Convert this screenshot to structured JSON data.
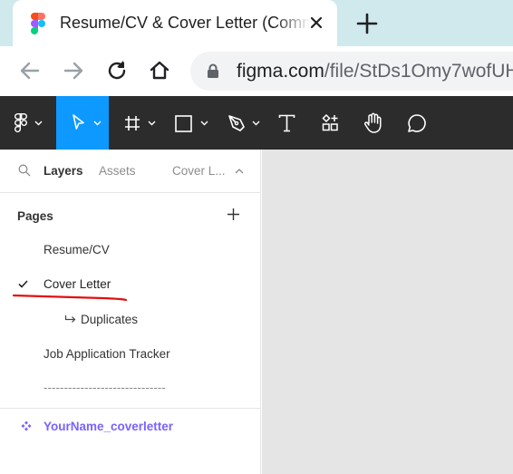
{
  "browser": {
    "tab_title": "Resume/CV & Cover Letter (Community)",
    "url_host": "figma.com",
    "url_path": "/file/StDs1Omy7wofUH"
  },
  "toolbar": {
    "tools": [
      "main-menu",
      "move",
      "frame",
      "shape",
      "pen",
      "text",
      "resources",
      "hand",
      "comment"
    ],
    "active_tool": "move",
    "accent_color": "#0d99ff"
  },
  "panel": {
    "tabs": {
      "layers": "Layers",
      "assets": "Assets",
      "page_selector": "Cover L..."
    },
    "pages_title": "Pages",
    "pages": [
      {
        "label": "Resume/CV",
        "selected": false
      },
      {
        "label": "Cover Letter",
        "selected": true
      },
      {
        "label": "Duplicates",
        "selected": false
      },
      {
        "label": "Job Application Tracker",
        "selected": false
      },
      {
        "label": "------------------------------",
        "selected": false
      }
    ],
    "layers": [
      {
        "label": "YourName_coverletter",
        "type": "component"
      }
    ],
    "component_color": "#7b61ff"
  }
}
